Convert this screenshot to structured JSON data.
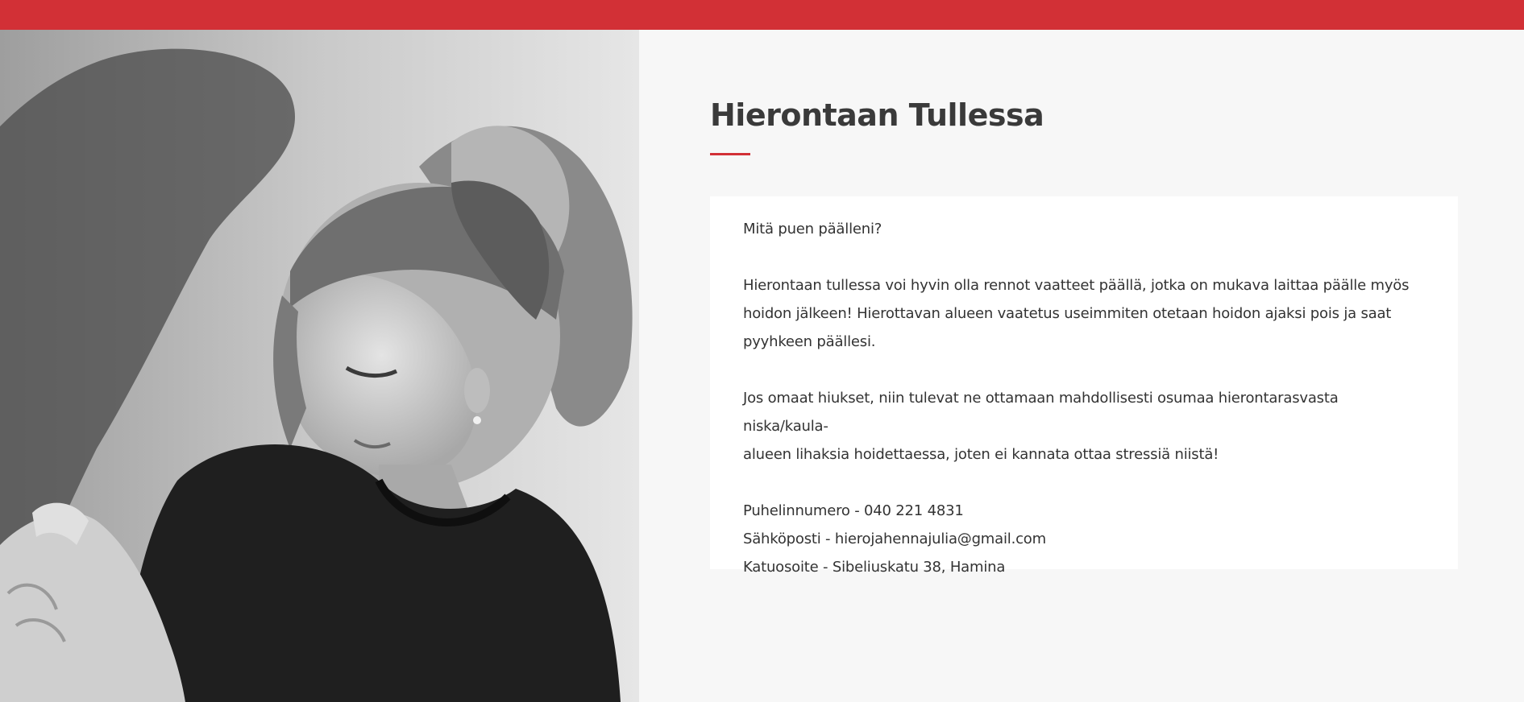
{
  "colors": {
    "accent": "#d23036",
    "background": "#f7f7f7",
    "card": "#ffffff",
    "text": "#333333"
  },
  "hero_image": {
    "description_icon": "photo-portrait"
  },
  "section": {
    "title": "Hierontaan Tullessa",
    "question": "Mitä puen päälleni?",
    "paragraph1_lines": [
      "Hierontaan tullessa voi hyvin olla rennot vaatteet päällä, jotka on mukava laittaa päälle myös",
      "hoidon jälkeen! Hierottavan alueen vaatetus useimmiten otetaan hoidon ajaksi pois ja saat",
      "pyyhkeen päällesi."
    ],
    "paragraph2_lines": [
      "Jos omaat hiukset, niin tulevat ne ottamaan mahdollisesti osumaa hierontarasvasta niska/kaula-",
      "alueen lihaksia hoidettaessa, joten ei kannata ottaa stressiä niistä!"
    ],
    "contact": {
      "phone": "Puhelinnumero - 040 221 4831",
      "email": "Sähköposti - hierojahennajulia@gmail.com",
      "address": "Katuosoite - Sibeliuskatu 38, Hamina"
    }
  }
}
